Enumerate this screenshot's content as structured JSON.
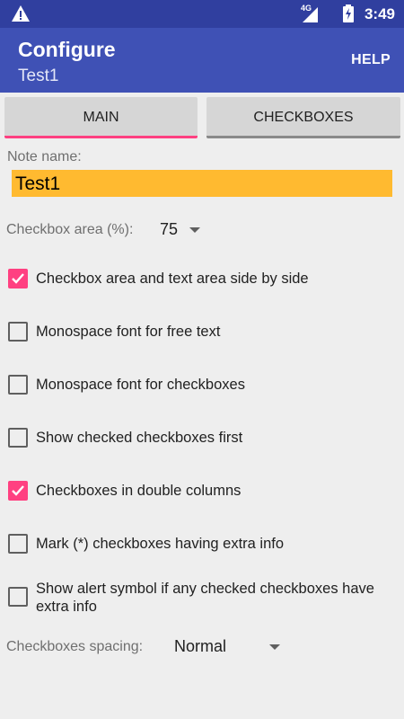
{
  "status_bar": {
    "time": "3:49",
    "network_label": "4G",
    "icons": [
      "alert-icon",
      "signal-icon",
      "battery-icon"
    ]
  },
  "app_bar": {
    "title": "Configure",
    "subtitle": "Test1",
    "help_label": "HELP"
  },
  "tabs": [
    {
      "label": "MAIN",
      "selected": true
    },
    {
      "label": "CHECKBOXES",
      "selected": false
    }
  ],
  "note": {
    "label": "Note name:",
    "value": "Test1"
  },
  "checkbox_area": {
    "label": "Checkbox area (%):",
    "value": "75"
  },
  "options": [
    {
      "label": "Checkbox area and text area side by side",
      "checked": true
    },
    {
      "label": "Monospace font for free text",
      "checked": false
    },
    {
      "label": "Monospace font for checkboxes",
      "checked": false
    },
    {
      "label": "Show checked checkboxes first",
      "checked": false
    },
    {
      "label": "Checkboxes in double columns",
      "checked": true
    },
    {
      "label": "Mark (*) checkboxes having extra info",
      "checked": false
    },
    {
      "label": "Show alert symbol if any checked checkboxes have extra info",
      "checked": false
    }
  ],
  "spacing": {
    "label": "Checkboxes spacing:",
    "value": "Normal"
  },
  "colors": {
    "status_bar": "#303f9f",
    "app_bar": "#3f51b5",
    "accent": "#ff4081",
    "note_field": "#ffba30"
  }
}
